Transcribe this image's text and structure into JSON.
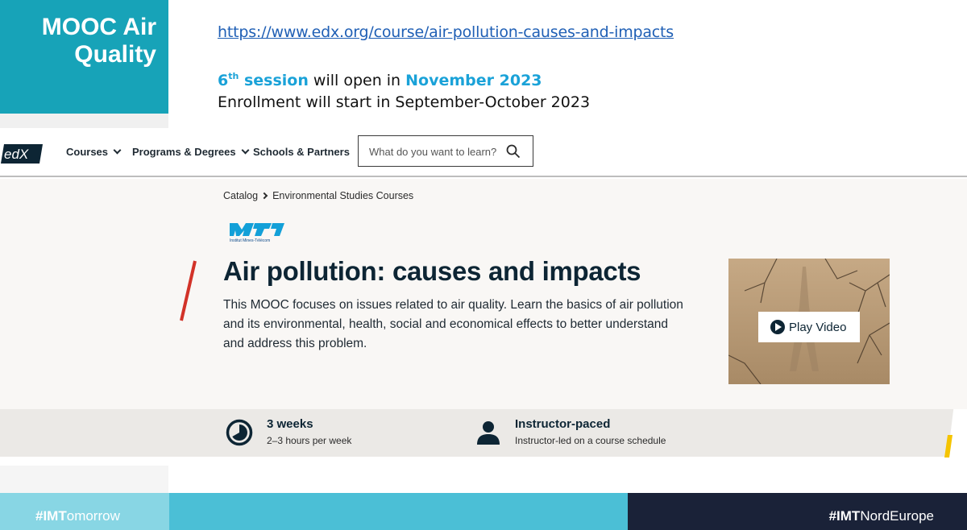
{
  "slide": {
    "title_line1": "MOOC Air",
    "title_line2": "Quality",
    "url": "https://www.edx.org/course/air-pollution-causes-and-impacts",
    "session_ordinal": "6",
    "session_ordinal_suffix": "th",
    "session_word": " session",
    "session_middle": " will open in ",
    "session_date": "November 2023",
    "enrollment": "Enrollment will start in September-October 2023"
  },
  "edx_header": {
    "logo": "edX",
    "nav": [
      "Courses",
      "Programs & Degrees",
      "Schools & Partners"
    ],
    "search_placeholder": "What do you want to learn?"
  },
  "breadcrumb": [
    "Catalog",
    "Environmental Studies Courses"
  ],
  "partner_logo_text": "Institut Mines-Télécom",
  "course": {
    "title": "Air pollution: causes and impacts",
    "description": "This MOOC focuses on issues related to air quality. Learn the basics of air pollution and its environmental, health, social and economical effects to better understand and address this problem.",
    "video_button": "Play Video"
  },
  "info": {
    "duration_title": "3 weeks",
    "duration_sub": "2–3 hours per week",
    "pace_title": "Instructor-paced",
    "pace_sub": "Instructor-led on a course schedule"
  },
  "footer": {
    "left_tag_bold": "#IMT",
    "left_tag_rest": "omorrow",
    "right_tag_bold": "#IMT",
    "right_tag_rest": "NordEurope"
  },
  "colors": {
    "teal": "#17a3b8",
    "link_blue": "#1f5fb5",
    "highlight_blue": "#1aa2d8",
    "edx_navy": "#0d2534",
    "accent_red": "#d23228",
    "accent_yellow": "#f5c400",
    "footer_dark": "#1a2238"
  }
}
